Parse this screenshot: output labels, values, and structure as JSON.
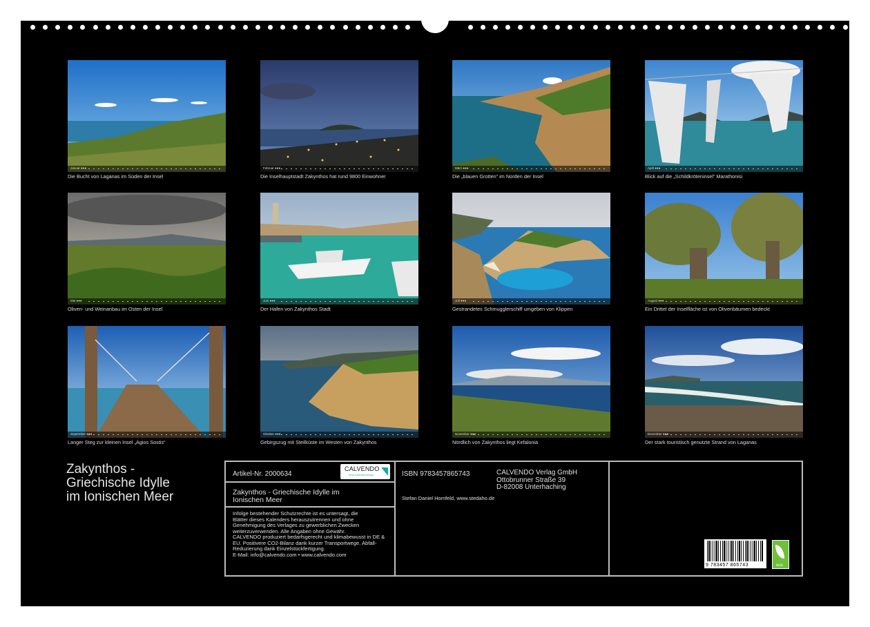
{
  "tiles": [
    {
      "month": "Januar ●●●",
      "caption": "Die Bucht von Laganas im Süden der Insel"
    },
    {
      "month": "Februar ●●●",
      "caption": "Die Inselhauptstadt Zakynthos hat rund 9800 Einwohner"
    },
    {
      "month": "März ●●●",
      "caption": "Die „blauen Grotten“ im Norden der Insel"
    },
    {
      "month": "April ●●●",
      "caption": "Blick auf die „Schildkröteninsel“ Marathonisi"
    },
    {
      "month": "Mai ●●●",
      "caption": "Oliven- und Weinanbau im Osten der Insel"
    },
    {
      "month": "Juni ●●●",
      "caption": "Der Hafen von Zakynthos Stadt"
    },
    {
      "month": "Juli ●●●",
      "caption": "Gestrandetes Schmugglerschiff umgeben von Klippen"
    },
    {
      "month": "August ●●●",
      "caption": "Ein Drittel der Inselfläche ist von Olivenbäumen bedeckt"
    },
    {
      "month": "September ●●●",
      "caption": "Langer Steg zur kleinen Insel „Agios Sostis“"
    },
    {
      "month": "Oktober ●●●",
      "caption": "Gebirgszug mit Steilküste im Westen von Zakynthos"
    },
    {
      "month": "November ●●●",
      "caption": "Nördlich von Zakynthos liegt Kefalonia"
    },
    {
      "month": "Dezember ●●●",
      "caption": "Der stark touristisch genutzte Strand von Laganas"
    }
  ],
  "title_lines": [
    "Zakynthos -",
    "Griechische Idylle",
    "im Ionischen Meer"
  ],
  "info": {
    "article": "Artikel-Nr. 2000634",
    "logo_text": "CALVENDO",
    "logo_sub": "best Kalenderverlag",
    "product_title_1": "Zakynthos - Griechische Idylle im",
    "product_title_2": "Ionischen Meer",
    "legal_lines": [
      "Infolge bestehender Schutzrechte ist es untersagt, die",
      "Blätter dieses Kalenders herauszutrennen und ohne",
      "Genehmigung des Verlages zu gewerblichen Zwecken",
      "weiterzuverwenden. Alle Angaben ohne Gewähr.",
      "CALVENDO produziert bedarfsgerecht und klimabewusst in DE &",
      "EU. Positivere CO2-Bilanz dank kurzer Transportwege. Abfall-",
      "Reduzierung dank Einzelstückfertigung.",
      "E-Mail: info@calvendo.com • www.calvendo.com"
    ],
    "isbn": "ISBN 9783457865743",
    "publisher_lines": [
      "CALVENDO Verlag GmbH",
      "Ottobrunner Straße 39",
      "D-82008 Unterhaching"
    ],
    "author": "Stefan Daniel Homfeld, www.stedaho.de",
    "barcode_number": "9 783457 865743",
    "eco_label": "eco"
  }
}
